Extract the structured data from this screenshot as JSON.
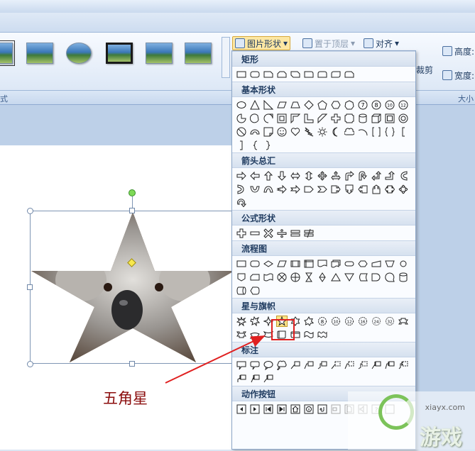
{
  "ribbon": {
    "picture_shape_label": "图片形状",
    "bring_to_front_label": "置于顶层",
    "align_label": "对齐",
    "crop_label": "裁剪",
    "height_label": "高度:",
    "width_label": "宽度:",
    "left_group_label": "式",
    "size_group_label": "大小"
  },
  "dropdown": {
    "sections": [
      {
        "title": "矩形"
      },
      {
        "title": "基本形状"
      },
      {
        "title": "箭头总汇"
      },
      {
        "title": "公式形状"
      },
      {
        "title": "流程图"
      },
      {
        "title": "星与旗帜"
      },
      {
        "title": "标注"
      },
      {
        "title": "动作按钮"
      }
    ],
    "selected_shape": "五角星"
  },
  "annotation": {
    "text": "五角星"
  },
  "watermark": {
    "url": "xiayx.com",
    "brand": "游戏"
  },
  "colors": {
    "highlight": "#fbe48a",
    "annotation_red": "#e02020",
    "annotation_text": "#8b0d0d",
    "rotation_handle": "#7ed957",
    "adjust_handle": "#f7e84d"
  }
}
